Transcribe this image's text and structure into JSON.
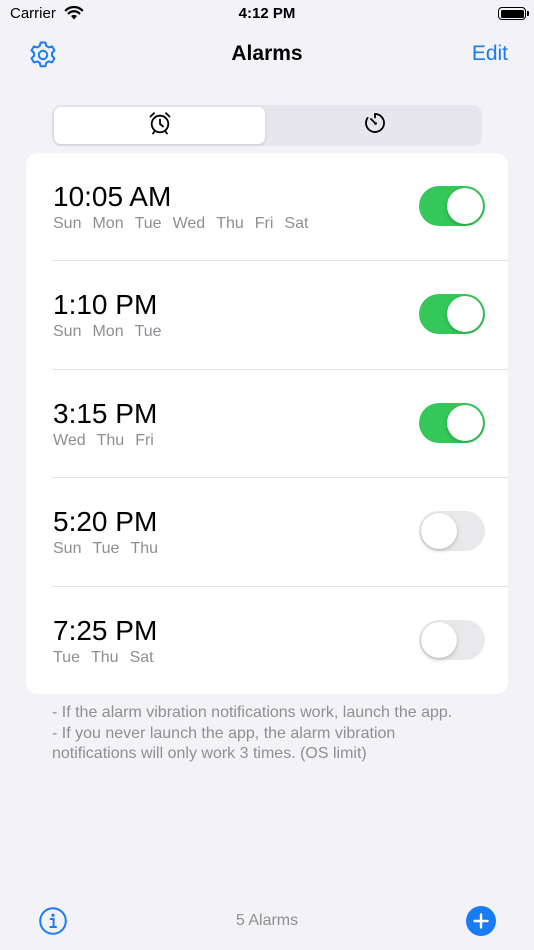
{
  "status_bar": {
    "carrier": "Carrier",
    "time": "4:12 PM"
  },
  "nav": {
    "title": "Alarms",
    "edit_label": "Edit",
    "left_icon": "gear-icon"
  },
  "segments": [
    {
      "icon": "alarm-clock-icon",
      "selected": true
    },
    {
      "icon": "timer-icon",
      "selected": false
    }
  ],
  "alarms": [
    {
      "time": "10:05 AM",
      "days": [
        "Sun",
        "Mon",
        "Tue",
        "Wed",
        "Thu",
        "Fri",
        "Sat"
      ],
      "enabled": true
    },
    {
      "time": "1:10 PM",
      "days": [
        "Sun",
        "Mon",
        "Tue"
      ],
      "enabled": true
    },
    {
      "time": "3:15 PM",
      "days": [
        "Wed",
        "Thu",
        "Fri"
      ],
      "enabled": true
    },
    {
      "time": "5:20 PM",
      "days": [
        "Sun",
        "Tue",
        "Thu"
      ],
      "enabled": false
    },
    {
      "time": "7:25 PM",
      "days": [
        "Tue",
        "Thu",
        "Sat"
      ],
      "enabled": false
    }
  ],
  "notes": {
    "line1": "- If the alarm vibration notifications work, launch the app.",
    "line2": "- If you never launch the app, the alarm vibration notifications will only work 3 times. (OS limit)"
  },
  "toolbar": {
    "count_label": "5 Alarms",
    "left_icon": "info-icon",
    "right_icon": "plus-icon"
  },
  "colors": {
    "accent": "#1a7cf4",
    "switch_on": "#34c759",
    "switch_off": "#e9e9eb",
    "secondary_text": "#8e8e93"
  }
}
